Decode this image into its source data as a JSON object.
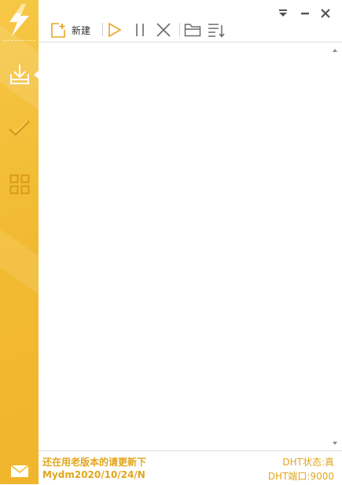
{
  "toolbar": {
    "new_label": "新建"
  },
  "status": {
    "notice_line1": "还在用老版本的请更新下",
    "notice_line2": "Mydm2020/10/24/N",
    "dht_status": "DHT状态:真",
    "dht_port": "DHT端口:9000"
  },
  "icons": {
    "logo": "lightning-icon",
    "download": "download-icon",
    "completed": "checkmark-icon",
    "apps": "grid-icon",
    "mail": "mail-icon",
    "new": "new-task-icon",
    "start": "play-icon",
    "pause": "pause-icon",
    "delete": "close-icon",
    "folder": "folder-icon",
    "sort": "sort-list-icon"
  },
  "colors": {
    "accent": "#f2bb33",
    "accent_text": "#e2a61d",
    "icon_orange": "#e8a525",
    "icon_gray": "#6b6b6b"
  }
}
